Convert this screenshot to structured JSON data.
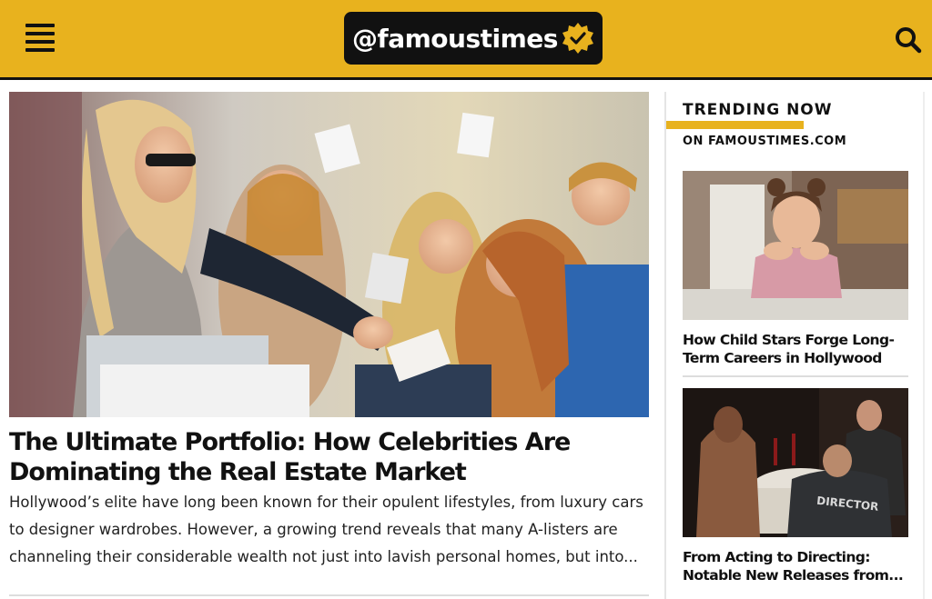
{
  "header": {
    "logo_text": "@famoustimes",
    "brand_color": "#e8b21e",
    "icons": {
      "menu": "hamburger-menu-icon",
      "verified": "verified-badge-icon",
      "search": "search-icon"
    }
  },
  "main": {
    "image_alt": "Blonde celebrity in sunglasses signing autographs for a crowd of excited fans",
    "title": "The Ultimate Portfolio: How Celebrities Are Dominating the Real Estate Market",
    "excerpt": "Hollywood’s elite have long been known for their opulent lifestyles, from luxury cars to designer wardrobes. However, a growing trend reveals that many A-listers are channeling their considerable wealth not just into lavish personal homes, but into..."
  },
  "sidebar": {
    "heading": "TRENDING NOW",
    "subheading": "ON FAMOUSTIMES.COM",
    "items": [
      {
        "title": "How Child Stars Forge Long-Term Careers in Hollywood",
        "image_alt": "Smiling young girl leaning on a kitchen counter"
      },
      {
        "title": "From Acting to Directing: Notable New Releases from...",
        "image_alt": "Film set with a man wearing a DIRECTOR shirt at a dinner table scene",
        "image_text": "DIRECTOR"
      }
    ]
  }
}
